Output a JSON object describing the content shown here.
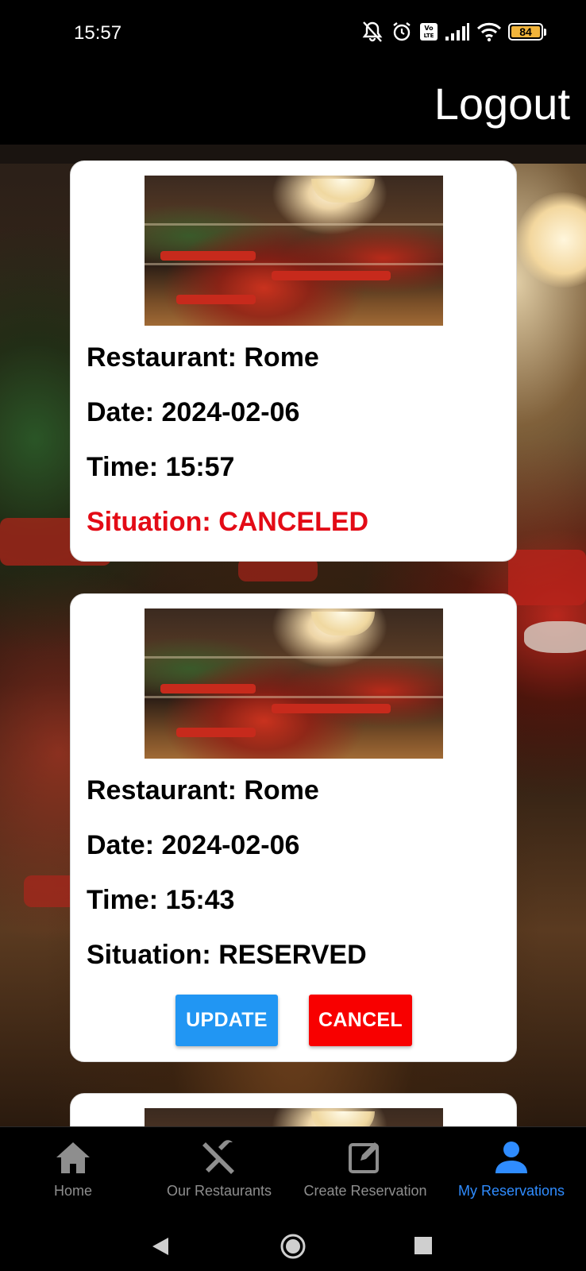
{
  "status_bar": {
    "time": "15:57",
    "battery": "84"
  },
  "header": {
    "logout_label": "Logout"
  },
  "reservations": [
    {
      "restaurant": "Restaurant: Rome",
      "date": "Date: 2024-02-06",
      "time": "Time: 15:57",
      "situation": "Situation: CANCELED"
    },
    {
      "restaurant": "Restaurant: Rome",
      "date": "Date: 2024-02-06",
      "time": "Time: 15:43",
      "situation": "Situation: RESERVED",
      "update_label": "UPDATE",
      "cancel_label": "CANCEL"
    }
  ],
  "tabs": [
    {
      "label": "Home",
      "icon": "home-icon"
    },
    {
      "label": "Our Restaurants",
      "icon": "utensils-icon"
    },
    {
      "label": "Create Reservation",
      "icon": "edit-icon"
    },
    {
      "label": "My Reservations",
      "icon": "user-icon",
      "active": true
    }
  ],
  "colors": {
    "accent": "#2f8cff",
    "update": "#2196f3",
    "cancel": "#f80000",
    "canceled_text": "#e30b16"
  }
}
